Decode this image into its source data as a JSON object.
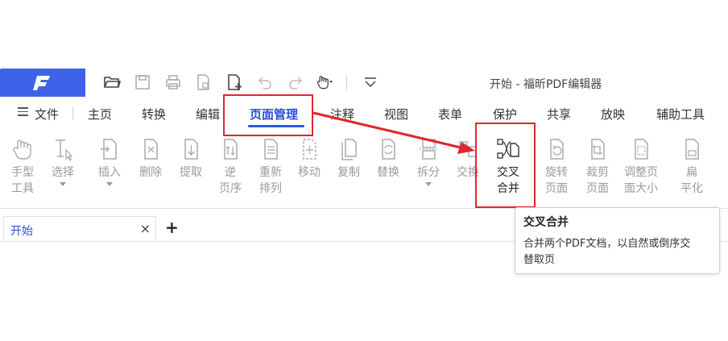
{
  "app": {
    "title": "开始 - 福昕PDF编辑器",
    "brand_color": "#3f63e8",
    "accent_color": "#2b4fd8",
    "annotation_color": "#e0262d"
  },
  "quickbar": {
    "icons": [
      "logo-icon",
      "open-folder-icon",
      "save-icon",
      "print-icon",
      "export-page-icon",
      "new-page-icon",
      "undo-icon",
      "redo-icon",
      "hand-tool-icon",
      "customize-dropdown-icon"
    ]
  },
  "menu": {
    "file": "文件",
    "items": [
      "主页",
      "转换",
      "编辑",
      "页面管理",
      "注释",
      "视图",
      "表单",
      "保护",
      "共享",
      "放映",
      "辅助工具"
    ],
    "active": "页面管理"
  },
  "ribbon": {
    "hand": [
      "手型",
      "工具"
    ],
    "select": [
      "选择"
    ],
    "insert": [
      "插入"
    ],
    "delete": [
      "删除"
    ],
    "extract": [
      "提取"
    ],
    "reverse": [
      "逆",
      "页序"
    ],
    "reorder": [
      "重新",
      "排列"
    ],
    "move": [
      "移动"
    ],
    "copy": [
      "复制"
    ],
    "replace": [
      "替换"
    ],
    "split": [
      "拆分"
    ],
    "swap": [
      "交换"
    ],
    "interleave": [
      "交叉",
      "合并"
    ],
    "rotate": [
      "旋转",
      "页面"
    ],
    "crop": [
      "裁剪",
      "页面"
    ],
    "resize": [
      "调整页",
      "面大小"
    ],
    "flatten": [
      "扁",
      "平化"
    ]
  },
  "tabs": {
    "doc_title": "开始",
    "close": "×",
    "add": "+"
  },
  "tooltip": {
    "title": "交叉合并",
    "body_line1": "合并两个PDF文档，以自然或倒序交",
    "body_line2": "替取页"
  }
}
